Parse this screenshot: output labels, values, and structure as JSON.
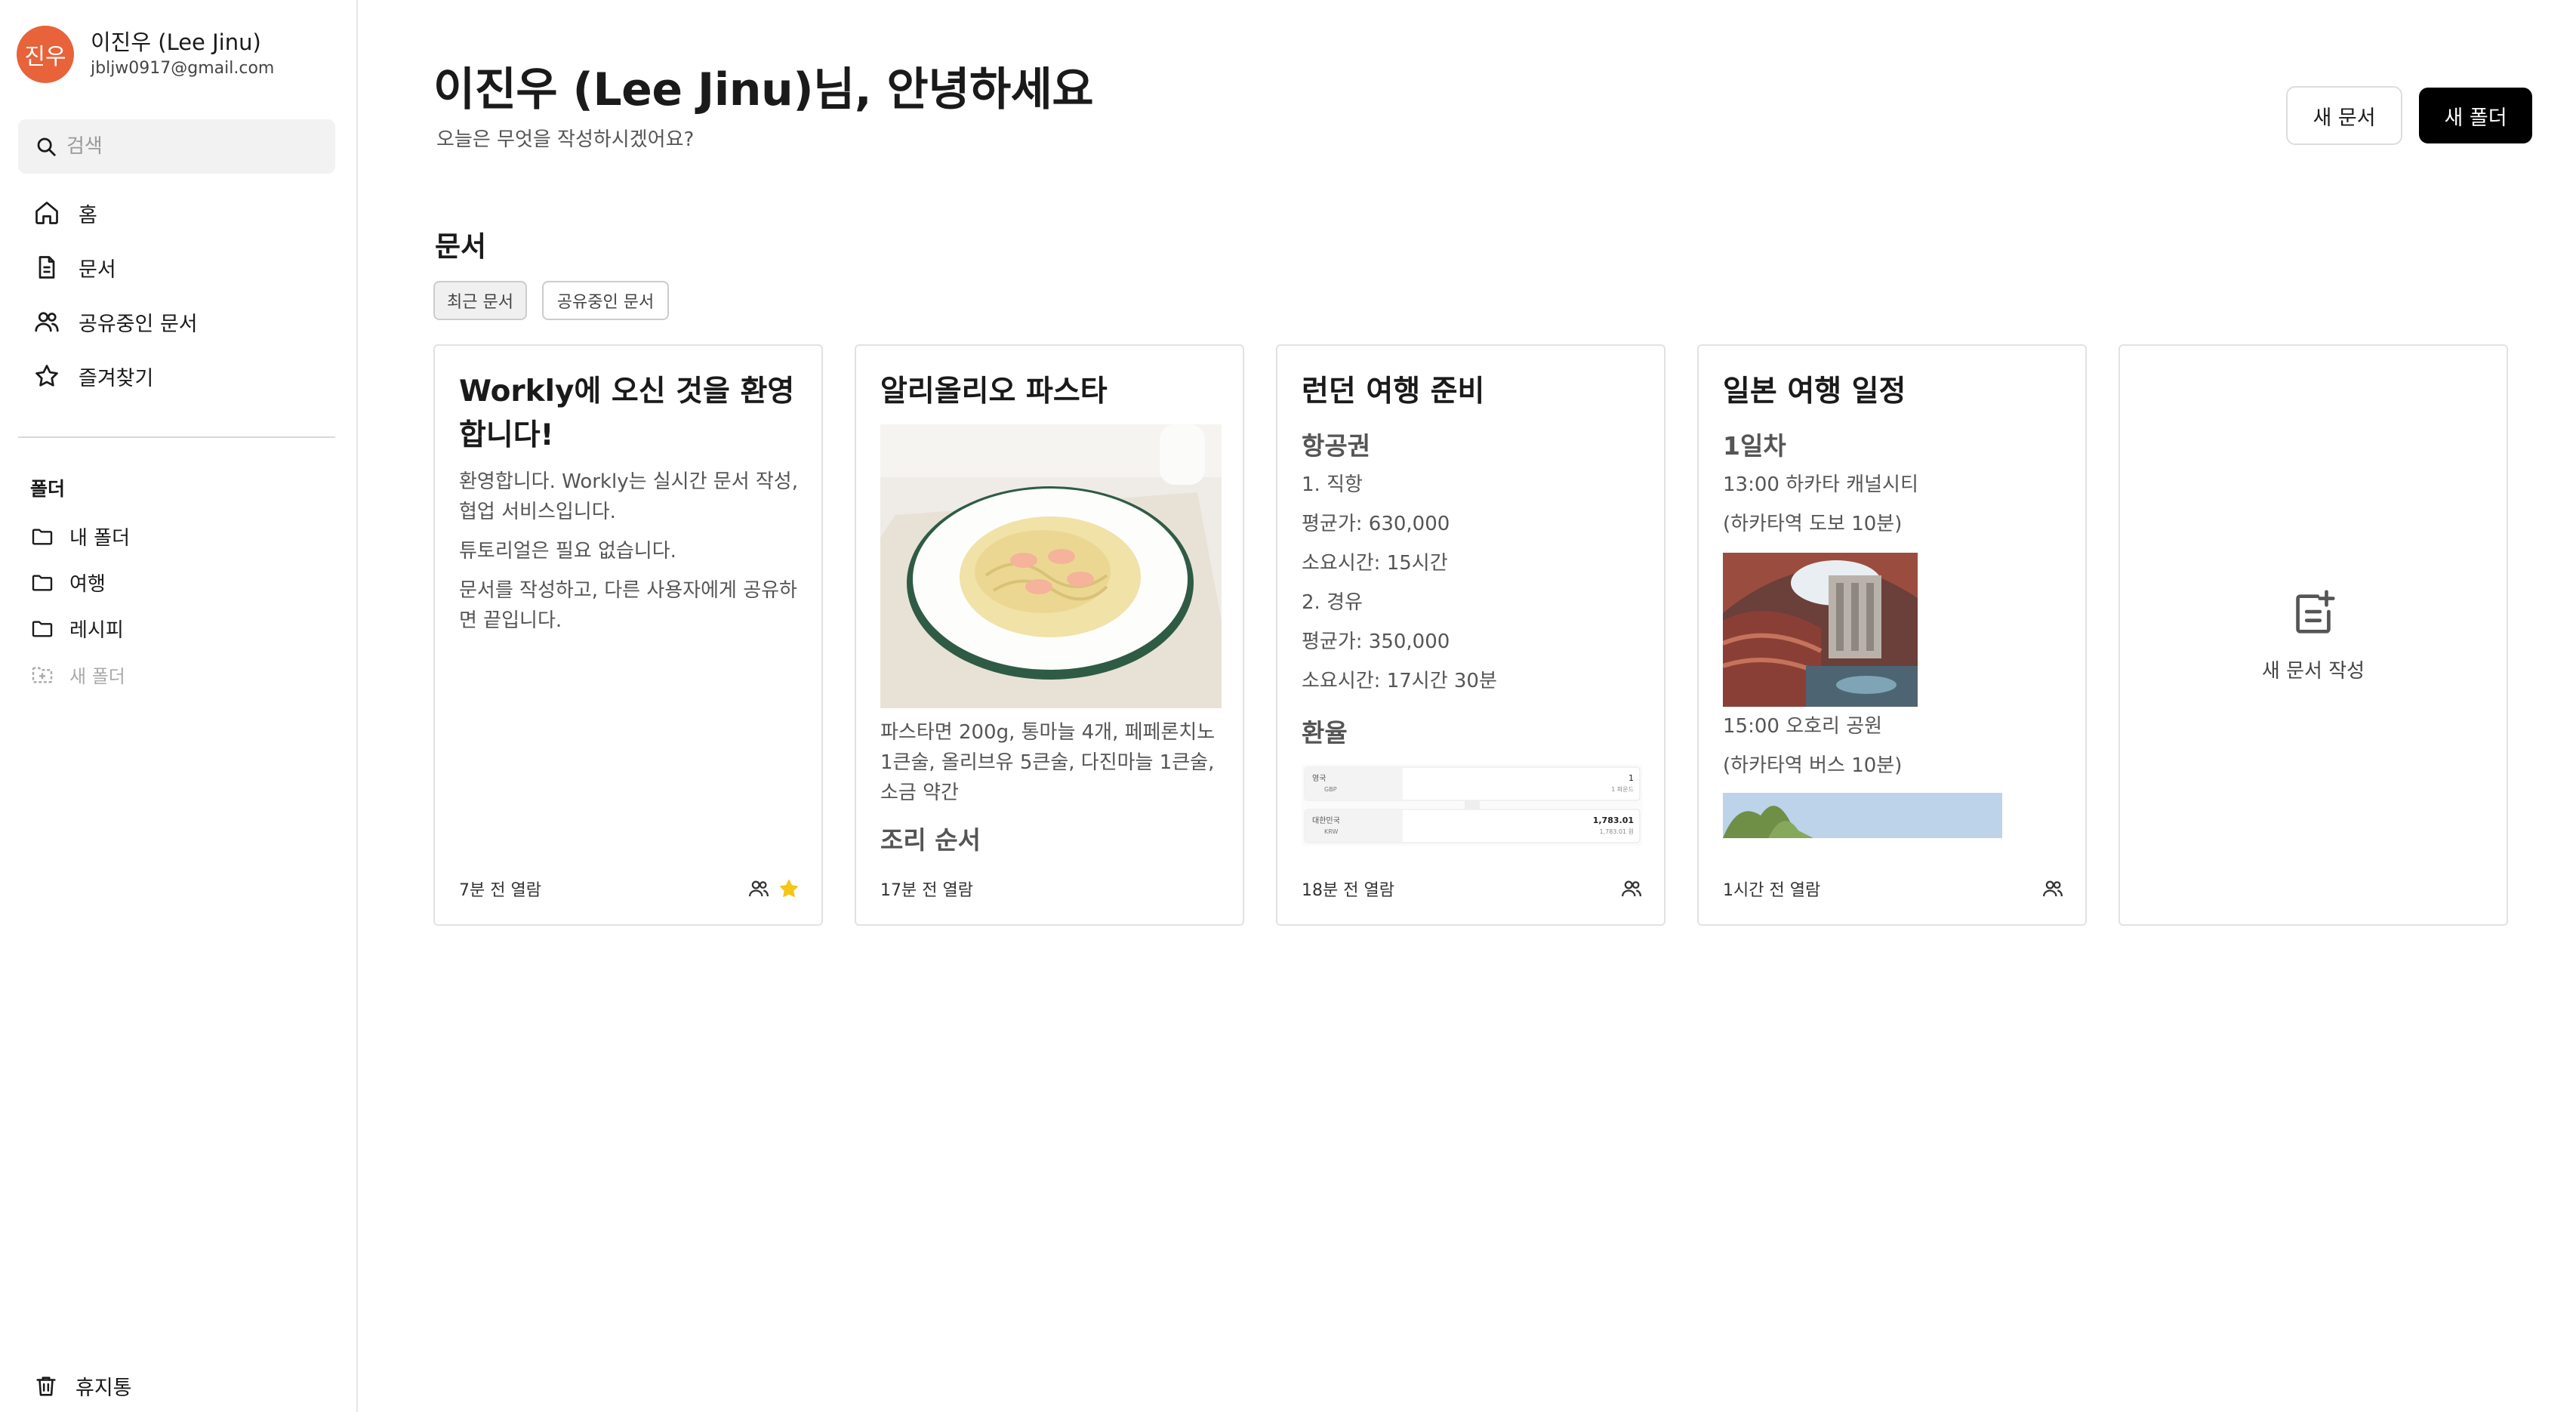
{
  "user": {
    "avatar_text": "진우",
    "name": "이진우 (Lee Jinu)",
    "email": "jbljw0917@gmail.com"
  },
  "search": {
    "placeholder": "검색"
  },
  "nav": [
    {
      "label": "홈",
      "icon": "home-icon"
    },
    {
      "label": "문서",
      "icon": "document-icon"
    },
    {
      "label": "공유중인 문서",
      "icon": "users-icon"
    },
    {
      "label": "즐겨찾기",
      "icon": "star-icon"
    }
  ],
  "folders": {
    "title": "폴더",
    "items": [
      "내 폴더",
      "여행",
      "레시피"
    ],
    "new_folder_label": "새 폴더"
  },
  "trash_label": "휴지통",
  "header": {
    "greeting": "이진우 (Lee Jinu)님, 안녕하세요",
    "subtitle": "오늘은 무엇을 작성하시겠어요?",
    "new_doc_button": "새 문서",
    "new_folder_button": "새 폴더"
  },
  "documents": {
    "section_title": "문서",
    "filters": [
      "최근 문서",
      "공유중인 문서"
    ],
    "active_filter": "최근 문서",
    "new_doc_card_label": "새 문서 작성",
    "cards": [
      {
        "title": "Workly에 오신 것을 환영합니다!",
        "paragraphs": [
          "환영합니다. Workly는 실시간 문서 작성, 협업 서비스입니다.",
          "튜토리얼은 필요 없습니다.",
          "문서를 작성하고, 다른 사용자에게 공유하면 끝입니다."
        ],
        "time": "7분 전 열람",
        "shared": true,
        "favorite": true
      },
      {
        "title": "알리올리오 파스타",
        "paragraph": "파스타면 200g, 통마늘 4개, 페페론치노 1큰술, 올리브유 5큰술, 다진마늘 1큰술, 소금 약간",
        "cutoff_heading": "조리 순서",
        "time": "17분 전 열람",
        "shared": false,
        "favorite": false
      },
      {
        "title": "런던 여행 준비",
        "heading1": "항공권",
        "lines": [
          "1. 직항",
          "평균가: 630,000",
          "소요시간: 15시간",
          "2. 경유",
          "평균가: 350,000",
          "소요시간: 17시간 30분"
        ],
        "heading2": "환율",
        "fx": {
          "from_country": "영국",
          "from_code": "GBP",
          "from_amount": "1",
          "from_sub": "1 파운드",
          "to_country": "대한민국",
          "to_code": "KRW",
          "to_amount": "1,783.01",
          "to_sub": "1,783.01 원"
        },
        "time": "18분 전 열람",
        "shared": true,
        "favorite": false
      },
      {
        "title": "일본 여행 일정",
        "heading1": "1일차",
        "lines_a": [
          "13:00 하카타 캐널시티",
          "(하카타역 도보 10분)"
        ],
        "lines_b": [
          "15:00 오호리 공원",
          "(하카타역 버스 10분)"
        ],
        "time": "1시간 전 열람",
        "shared": true,
        "favorite": false
      }
    ]
  },
  "colors": {
    "avatar": "#e8623a",
    "favorite_star": "#f5c518",
    "primary_button": "#000000"
  }
}
